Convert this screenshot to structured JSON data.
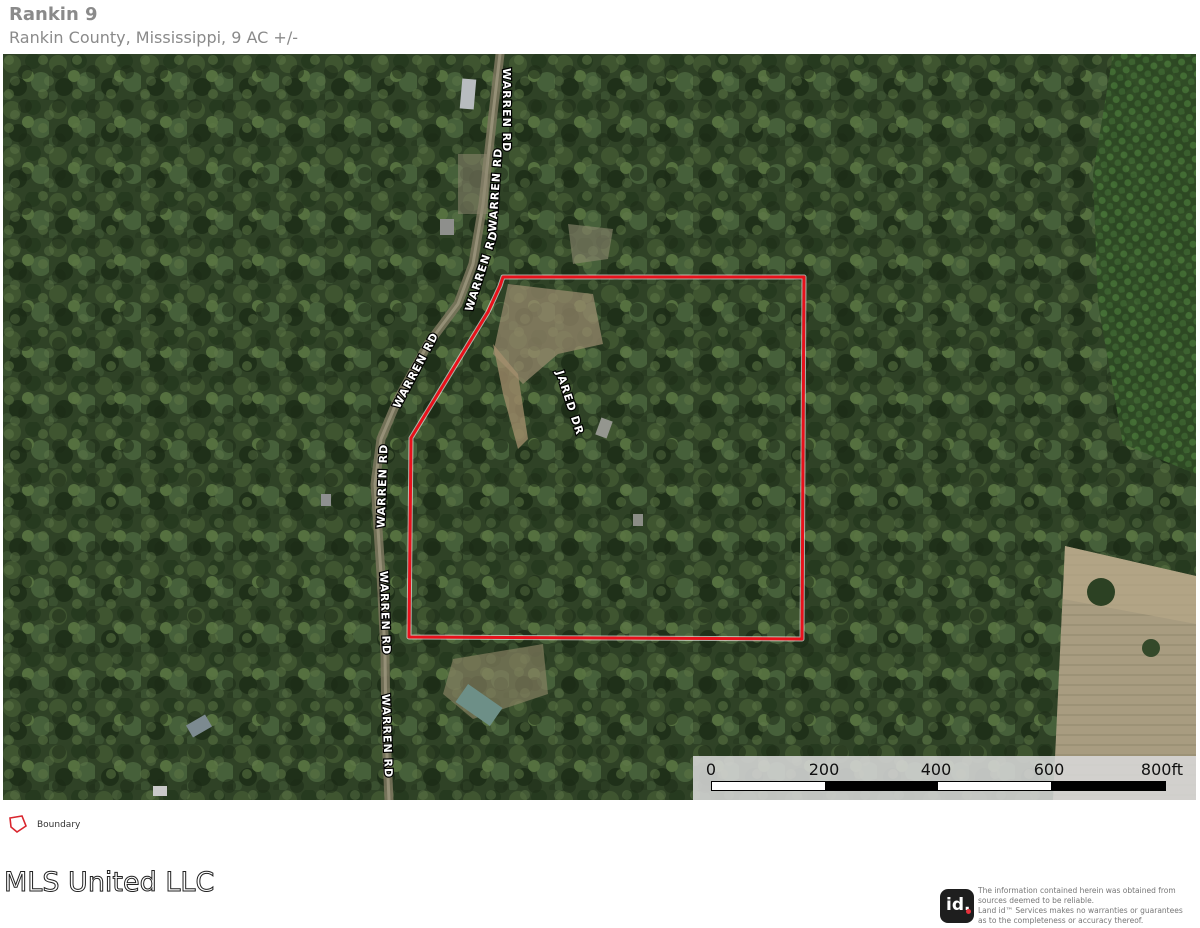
{
  "header": {
    "title": "Rankin 9",
    "subtitle": "Rankin County, Mississippi, 9 AC +/-"
  },
  "map": {
    "boundary_color": "#e8111b",
    "road_labels": [
      "WARREN RD",
      "WARREN RD",
      "WARREN RD",
      "WARREN RD",
      "WARREN RD",
      "WARREN RD",
      "JARED DR"
    ],
    "scale_bar": {
      "labels": [
        "0",
        "200",
        "400",
        "600",
        "800ft"
      ]
    }
  },
  "legend": {
    "items": [
      {
        "label": "Boundary",
        "icon": "boundary-polygon-icon",
        "color": "#d9262e"
      }
    ]
  },
  "footer": {
    "watermark": "MLS United LLC",
    "logo_text": "id.",
    "disclaimer_lines": [
      "The information contained herein was obtained from",
      "sources deemed to be reliable.",
      "Land id™ Services makes no warranties or guarantees",
      "as to the completeness or accuracy thereof."
    ]
  }
}
